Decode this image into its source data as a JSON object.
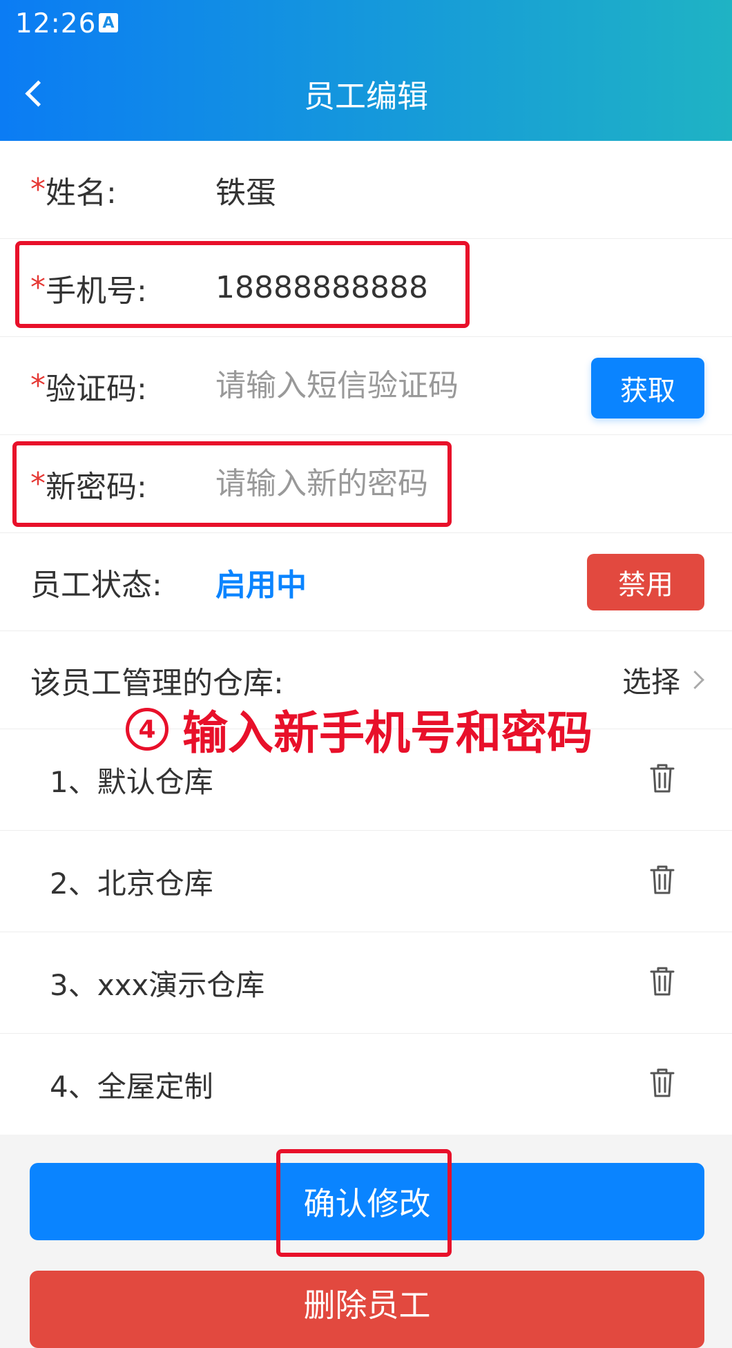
{
  "status_bar": {
    "time": "12:26",
    "icon_letter": "A"
  },
  "header": {
    "title": "员工编辑"
  },
  "form": {
    "name": {
      "required_mark": "*",
      "label": "姓名:",
      "value": "铁蛋"
    },
    "phone": {
      "required_mark": "*",
      "label": "手机号:",
      "value": "18888888888"
    },
    "code": {
      "required_mark": "*",
      "label": "验证码:",
      "placeholder": "请输入短信验证码",
      "button": "获取"
    },
    "password": {
      "required_mark": "*",
      "label": "新密码:",
      "placeholder": "请输入新的密码"
    },
    "status": {
      "label": "员工状态:",
      "value": "启用中",
      "button": "禁用"
    },
    "warehouses": {
      "label": "该员工管理的仓库:",
      "select": "选择"
    }
  },
  "warehouse_list": [
    {
      "label": "1、默认仓库"
    },
    {
      "label": "2、北京仓库"
    },
    {
      "label": "3、xxx演示仓库"
    },
    {
      "label": "4、全屋定制"
    }
  ],
  "annotation": {
    "number": "4",
    "text": "输入新手机号和密码"
  },
  "actions": {
    "confirm": "确认修改",
    "delete": "删除员工"
  },
  "colors": {
    "primary": "#0a84ff",
    "danger": "#e2493f",
    "annotation": "#e8102a"
  }
}
